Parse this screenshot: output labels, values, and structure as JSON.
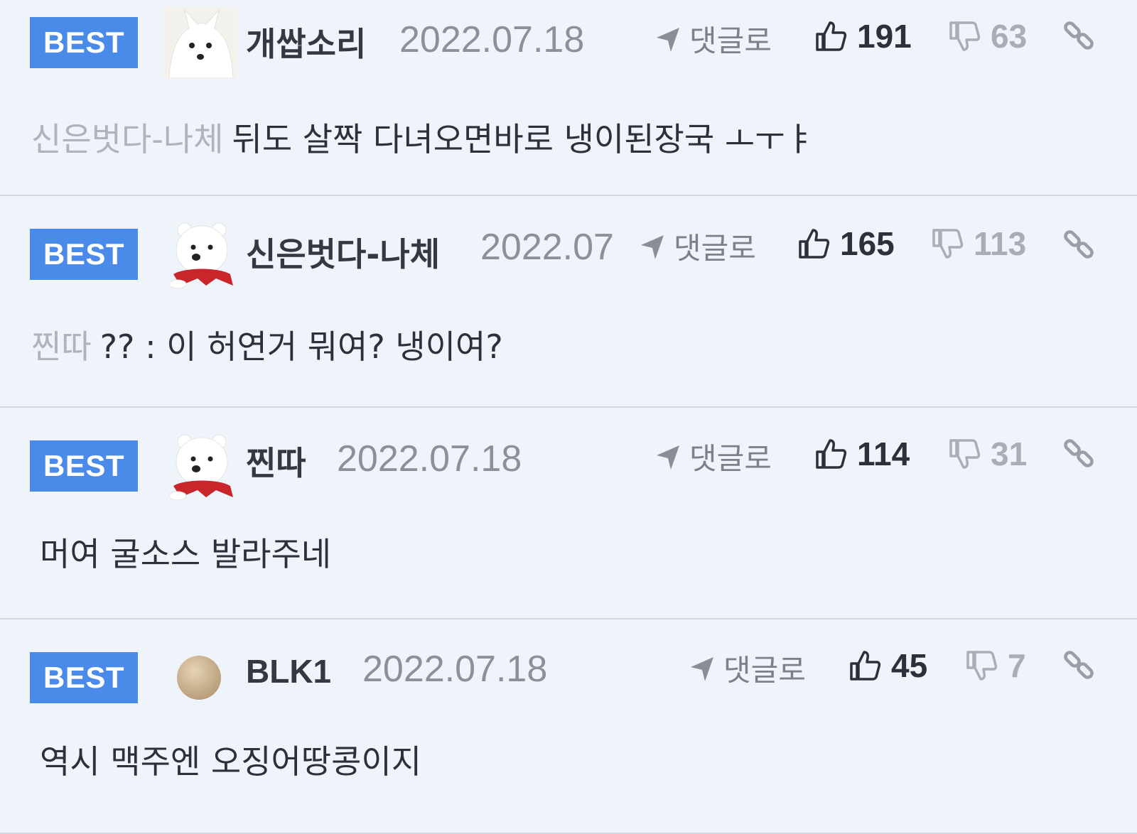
{
  "comments": [
    {
      "badge": "BEST",
      "author": "개쌉소리",
      "avatar": "white-fox-avatar",
      "date": "2022.07.18",
      "reply_label": "댓글로",
      "likes": "191",
      "dislikes": "63",
      "mention": "신은벗다-나체",
      "text": "뒤도 살짝 다녀오면바로 냉이된장국 ㅗㅜㅑ"
    },
    {
      "badge": "BEST",
      "author": "신은벗다-나체",
      "avatar": "polar-bear-avatar",
      "date": "2022.07",
      "reply_label": "댓글로",
      "likes": "165",
      "dislikes": "113",
      "mention": "찐따",
      "text": "?? : 이 허연거 뭐여? 냉이여?"
    },
    {
      "badge": "BEST",
      "author": "찐따",
      "avatar": "polar-bear-avatar",
      "date": "2022.07.18",
      "reply_label": "댓글로",
      "likes": "114",
      "dislikes": "31",
      "mention": "",
      "text": "머여 굴소스 발라주네"
    },
    {
      "badge": "BEST",
      "author": "BLK1",
      "avatar": "default-circle-avatar",
      "date": "2022.07.18",
      "reply_label": "댓글로",
      "likes": "45",
      "dislikes": "7",
      "mention": "",
      "text": "역시 맥주엔 오징어땅콩이지"
    }
  ],
  "colors": {
    "background": "#eff4fb",
    "badge": "#4a8ae8",
    "divider": "#cfd6df",
    "text": "#2c3039",
    "muted": "#8d9097"
  }
}
